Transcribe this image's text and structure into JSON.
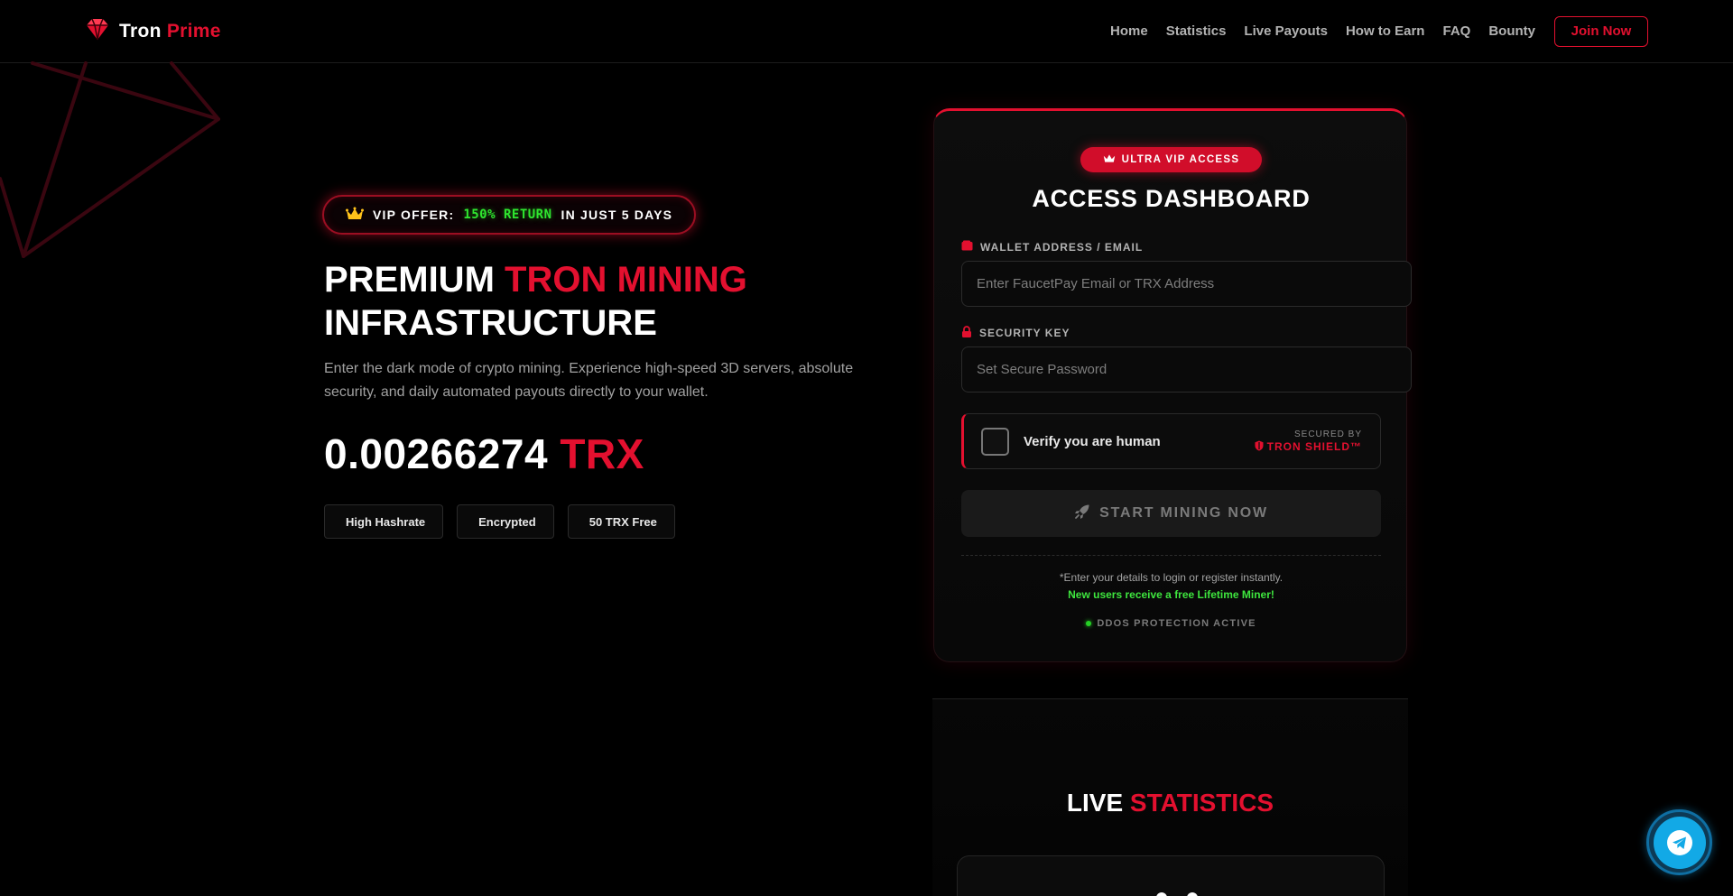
{
  "header": {
    "brand_first": "Tron",
    "brand_second": "Prime",
    "nav": [
      "Home",
      "Statistics",
      "Live Payouts",
      "How to Earn",
      "FAQ",
      "Bounty"
    ],
    "cta": "Join Now"
  },
  "hero": {
    "vip_label": "VIP OFFER:",
    "vip_highlight": "150% RETURN",
    "vip_suffix": "IN JUST 5 DAYS",
    "title_part1": "PREMIUM",
    "title_accent": "TRON MINING",
    "title_part2": "INFRASTRUCTURE",
    "description": "Enter the dark mode of crypto mining. Experience high-speed 3D servers, absolute security, and daily automated payouts directly to your wallet.",
    "balance_value": "0.00266274",
    "balance_unit": "TRX",
    "chips": [
      {
        "glyph": "",
        "label": "High Hashrate"
      },
      {
        "glyph": "",
        "label": "Encrypted"
      },
      {
        "glyph": "",
        "label": "50 TRX Free"
      }
    ]
  },
  "login": {
    "badge": "ULTRA VIP ACCESS",
    "title": "ACCESS DASHBOARD",
    "wallet_label": "WALLET ADDRESS / EMAIL",
    "wallet_placeholder": "Enter FaucetPay Email or TRX Address",
    "wallet_value": "",
    "security_label": "SECURITY KEY",
    "security_placeholder": "Set Secure Password",
    "security_value": "",
    "captcha_text": "Verify you are human",
    "captcha_secured_by": "SECURED BY",
    "captcha_brand": "TRON SHIELD™",
    "start_button": "START MINING NOW",
    "note_line1": "*Enter your details to login or register instantly.",
    "note_line2": "New users receive a free Lifetime Miner!",
    "protection_status": "DDOS PROTECTION ACTIVE"
  },
  "stats": {
    "title_part1": "LIVE",
    "title_accent": "STATISTICS"
  },
  "colors": {
    "accent": "#e3102f",
    "highlight_green": "#2fe62f",
    "telegram": "#12a9e6"
  },
  "icons": {
    "brand": "diamond-icon",
    "vip": "crown-icon",
    "badge": "crown-icon",
    "wallet": "wallet-icon",
    "security": "lock-icon",
    "captcha_brand": "shield-icon",
    "start": "rocket-icon",
    "status": "status-dot-icon",
    "float": "telegram-icon"
  }
}
